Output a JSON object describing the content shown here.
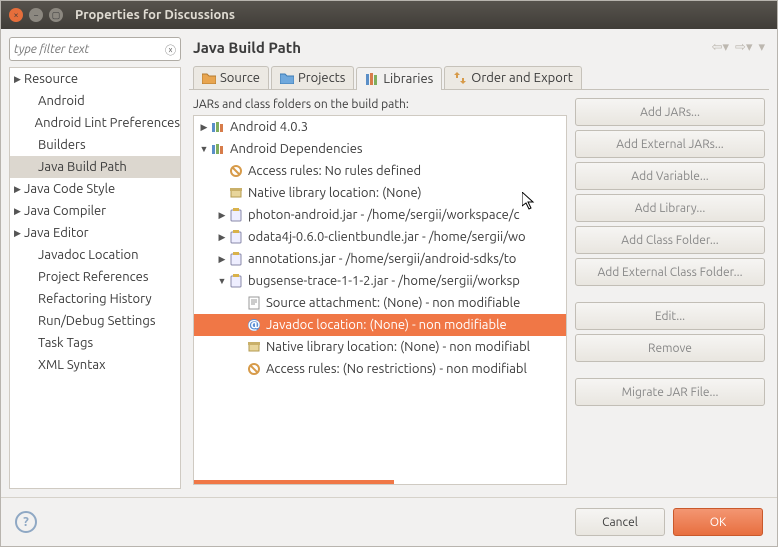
{
  "window": {
    "title": "Properties for Discussions"
  },
  "filter": {
    "placeholder": "type filter text"
  },
  "nav": [
    {
      "label": "Resource",
      "top": true
    },
    {
      "label": "Android"
    },
    {
      "label": "Android Lint Preferences"
    },
    {
      "label": "Builders"
    },
    {
      "label": "Java Build Path",
      "selected": true
    },
    {
      "label": "Java Code Style",
      "top": true
    },
    {
      "label": "Java Compiler",
      "top": true
    },
    {
      "label": "Java Editor",
      "top": true
    },
    {
      "label": "Javadoc Location"
    },
    {
      "label": "Project References"
    },
    {
      "label": "Refactoring History"
    },
    {
      "label": "Run/Debug Settings"
    },
    {
      "label": "Task Tags"
    },
    {
      "label": "XML Syntax"
    }
  ],
  "header": {
    "title": "Java Build Path"
  },
  "tabs": [
    {
      "label": "Source",
      "icon": "folder-orange"
    },
    {
      "label": "Projects",
      "icon": "folder-blue"
    },
    {
      "label": "Libraries",
      "icon": "books",
      "active": true
    },
    {
      "label": "Order and Export",
      "icon": "arrows"
    }
  ],
  "tree_label": "JARs and class folders on the build path:",
  "tree": [
    {
      "level": 1,
      "exp": "▶",
      "icon": "lib",
      "text": "Android 4.0.3"
    },
    {
      "level": 1,
      "exp": "▼",
      "icon": "lib",
      "text": "Android Dependencies"
    },
    {
      "level": 2,
      "exp": "",
      "icon": "access",
      "text": "Access rules: No rules defined"
    },
    {
      "level": 2,
      "exp": "",
      "icon": "native",
      "text": "Native library location: (None)"
    },
    {
      "level": 2,
      "exp": "▶",
      "icon": "jar",
      "text": "photon-android.jar - /home/sergii/workspace/c"
    },
    {
      "level": 2,
      "exp": "▶",
      "icon": "jar",
      "text": "odata4j-0.6.0-clientbundle.jar - /home/sergii/wo"
    },
    {
      "level": 2,
      "exp": "▶",
      "icon": "jar",
      "text": "annotations.jar - /home/sergii/android-sdks/to"
    },
    {
      "level": 2,
      "exp": "▼",
      "icon": "jar",
      "text": "bugsense-trace-1-1-2.jar - /home/sergii/worksp"
    },
    {
      "level": 3,
      "exp": "",
      "icon": "source",
      "text": "Source attachment: (None) - non modifiable"
    },
    {
      "level": 3,
      "exp": "",
      "icon": "javadoc",
      "text": "Javadoc location: (None) - non modifiable",
      "selected": true
    },
    {
      "level": 3,
      "exp": "",
      "icon": "native",
      "text": "Native library location: (None) - non modifiabl"
    },
    {
      "level": 3,
      "exp": "",
      "icon": "access",
      "text": "Access rules: (No restrictions) - non modifiabl"
    }
  ],
  "buttons": {
    "add_jars": "Add JARs...",
    "add_external_jars": "Add External JARs...",
    "add_variable": "Add Variable...",
    "add_library": "Add Library...",
    "add_class_folder": "Add Class Folder...",
    "add_external_class_folder": "Add External Class Folder...",
    "edit": "Edit...",
    "remove": "Remove",
    "migrate": "Migrate JAR File..."
  },
  "footer": {
    "cancel": "Cancel",
    "ok": "OK"
  }
}
